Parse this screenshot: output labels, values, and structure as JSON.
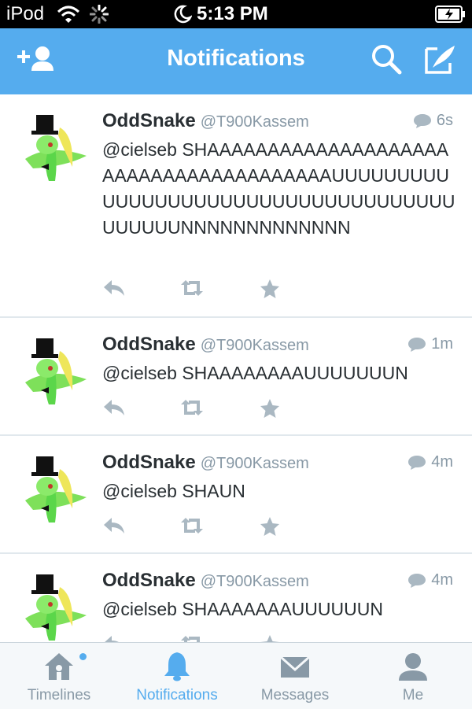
{
  "status_bar": {
    "carrier": "iPod",
    "time": "5:13 PM"
  },
  "nav": {
    "title": "Notifications"
  },
  "tweets": [
    {
      "name": "OddSnake",
      "handle": "@T900Kassem",
      "time": "6s",
      "text": "@cielseb SHAAAAAAAAAAAAAAAAAAAAAAAAAAAAAAAAAAAAAAAUUUUUUUUUUUUUUUUUUUUUUUUUUUUUUUUUUUUUUUUUUNNNNNNNNNNNNN"
    },
    {
      "name": "OddSnake",
      "handle": "@T900Kassem",
      "time": "1m",
      "text": "@cielseb SHAAAAAAAAUUUUUUUN"
    },
    {
      "name": "OddSnake",
      "handle": "@T900Kassem",
      "time": "4m",
      "text": "@cielseb SHAUN"
    },
    {
      "name": "OddSnake",
      "handle": "@T900Kassem",
      "time": "4m",
      "text": "@cielseb SHAAAAAAAUUUUUUN"
    }
  ],
  "tabs": [
    {
      "label": "Timelines",
      "icon": "home-icon",
      "active": false,
      "badge": true
    },
    {
      "label": "Notifications",
      "icon": "bell-icon",
      "active": true
    },
    {
      "label": "Messages",
      "icon": "envelope-icon",
      "active": false
    },
    {
      "label": "Me",
      "icon": "person-icon",
      "active": false
    }
  ],
  "colors": {
    "brand": "#55acee",
    "text": "#292f33",
    "muted": "#8899a6",
    "icon": "#aab8c2"
  }
}
